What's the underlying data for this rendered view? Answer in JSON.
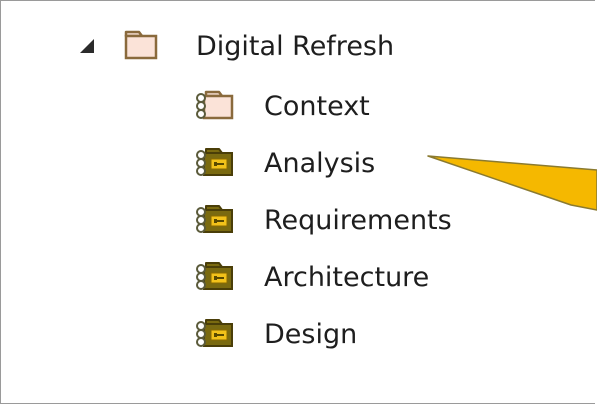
{
  "tree": {
    "root": {
      "label": "Digital Refresh",
      "icon": "folder-icon",
      "expanded": true
    },
    "children": [
      {
        "label": "Context",
        "icon": "package-icon"
      },
      {
        "label": "Analysis",
        "icon": "locked-package-icon"
      },
      {
        "label": "Requirements",
        "icon": "locked-package-icon"
      },
      {
        "label": "Architecture",
        "icon": "locked-package-icon"
      },
      {
        "label": "Design",
        "icon": "locked-package-icon"
      }
    ]
  },
  "colors": {
    "folder_fill": "#fbe3d8",
    "folder_stroke": "#8a6a3c",
    "locked_fill": "#7a6a10",
    "lock_badge": "#f2c21a",
    "callout_fill": "#f5b800",
    "callout_stroke": "#8a7a30"
  }
}
